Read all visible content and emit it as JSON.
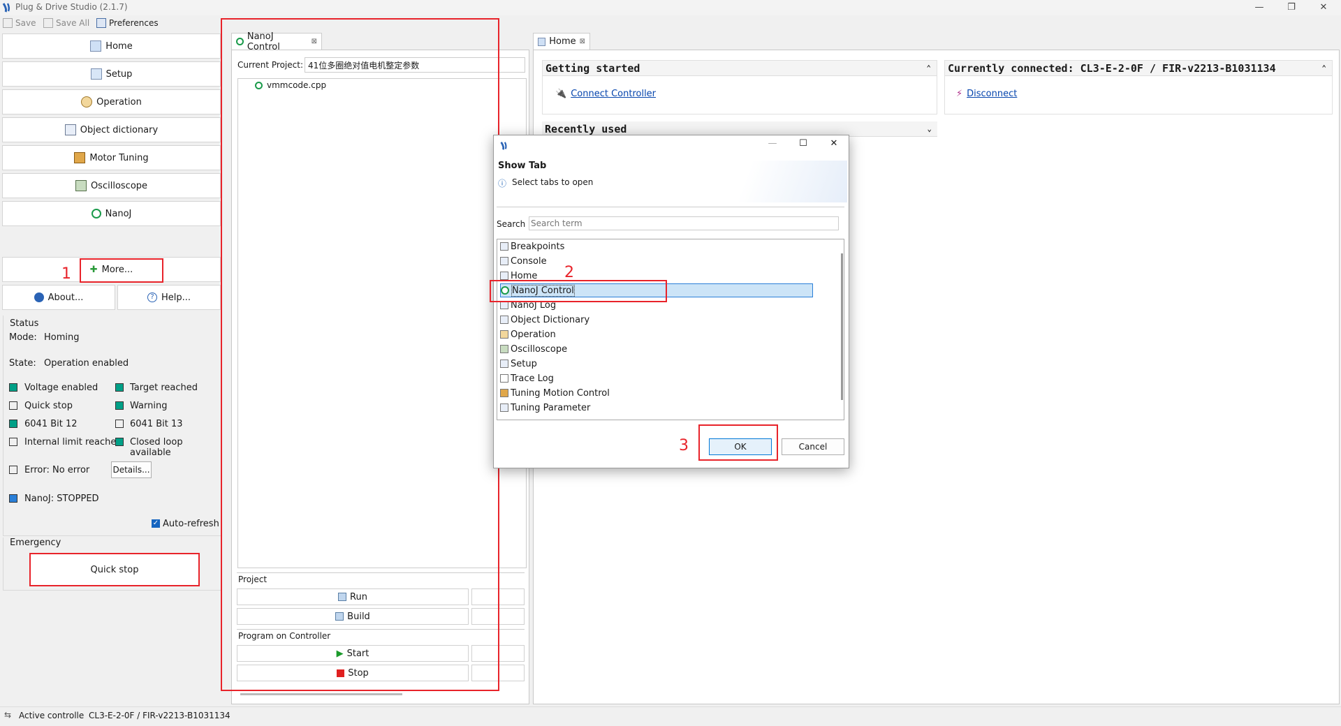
{
  "app": {
    "title": "Plug & Drive Studio (2.1.7)"
  },
  "toolbar": {
    "save": "Save",
    "save_all": "Save All",
    "preferences": "Preferences"
  },
  "nav": {
    "items": [
      {
        "label": "Home",
        "icon": "home-icon"
      },
      {
        "label": "Setup",
        "icon": "setup-icon"
      },
      {
        "label": "Operation",
        "icon": "gears-icon"
      },
      {
        "label": "Object dictionary",
        "icon": "table-icon"
      },
      {
        "label": "Motor Tuning",
        "icon": "wrench-icon"
      },
      {
        "label": "Oscilloscope",
        "icon": "oscilloscope-icon"
      },
      {
        "label": "NanoJ",
        "icon": "nanoj-icon"
      }
    ],
    "more": "More...",
    "about": "About...",
    "help": "Help..."
  },
  "status": {
    "title": "Status",
    "mode_label": "Mode:",
    "mode_value": "Homing",
    "state_label": "State:",
    "state_value": "Operation enabled",
    "flags": [
      {
        "label": "Voltage enabled",
        "on": true
      },
      {
        "label": "Target reached",
        "on": true
      },
      {
        "label": "Quick stop",
        "on": false
      },
      {
        "label": "Warning",
        "on": true
      },
      {
        "label": "6041 Bit 12",
        "on": true
      },
      {
        "label": "6041 Bit 13",
        "on": false
      },
      {
        "label": "Internal limit reached",
        "on": false
      },
      {
        "label": "Closed loop available",
        "on": true
      }
    ],
    "error": "Error:  No error",
    "details": "Details...",
    "nanoj": "NanoJ:  STOPPED",
    "auto_refresh": "Auto-refresh"
  },
  "emergency": {
    "title": "Emergency",
    "quick_stop": "Quick stop"
  },
  "nanoj_tab": {
    "tab_label": "NanoJ Control",
    "project_label": "Current Project:",
    "project_value": "41位多圈绝对值电机整定参数",
    "file": "vmmcode.cpp",
    "project_group": "Project",
    "run": "Run",
    "build": "Build",
    "program_group": "Program on Controller",
    "start": "Start",
    "stop": "Stop"
  },
  "home_tab": {
    "tab_label": "Home",
    "getting_started": "Getting started",
    "connect": "Connect Controller",
    "recently_used": "Recently used",
    "connected": "Currently connected: CL3-E-2-0F / FIR-v2213-B1031134",
    "disconnect": "Disconnect"
  },
  "dialog": {
    "title": "Show Tab",
    "subtitle": "Select tabs to open",
    "search_label": "Search",
    "search_placeholder": "Search term",
    "items": [
      "Breakpoints",
      "Console",
      "Home",
      "NanoJ Control",
      "NanoJ Log",
      "Object Dictionary",
      "Operation",
      "Oscilloscope",
      "Setup",
      "Trace Log",
      "Tuning Motion Control",
      "Tuning Parameter"
    ],
    "selected": "NanoJ Control",
    "ok": "OK",
    "cancel": "Cancel"
  },
  "annotations": {
    "n1": "1",
    "n2": "2",
    "n3": "3"
  },
  "statusbar": {
    "label": "Active controlle",
    "value": "CL3-E-2-0F / FIR-v2213-B1031134"
  },
  "colors": {
    "on": "#00a087",
    "accent_red": "#e8232a",
    "link": "#0645ad",
    "selection": "#cce4f7"
  }
}
